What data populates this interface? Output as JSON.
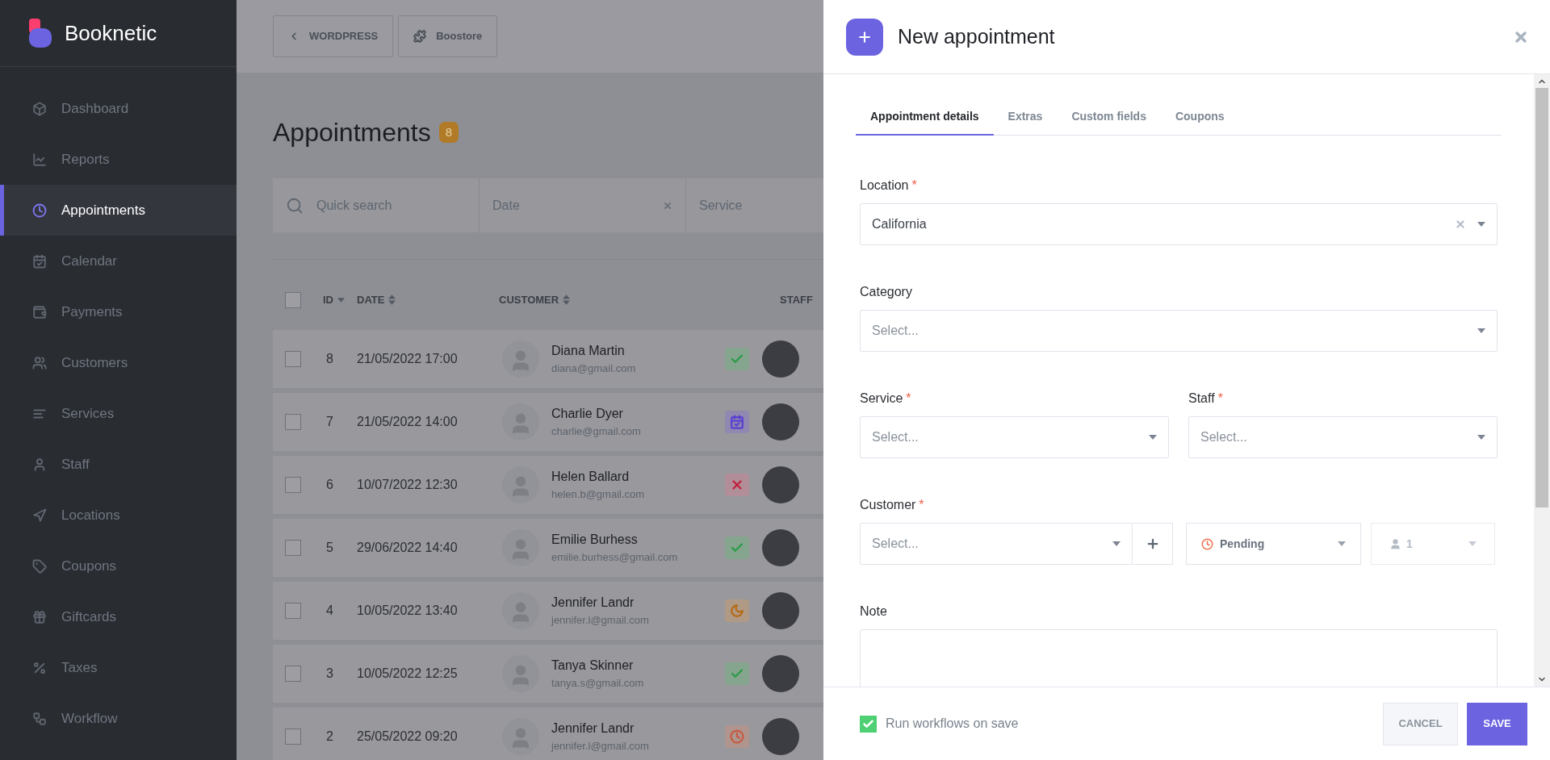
{
  "sidebar": {
    "brand": "Booknetic",
    "items": [
      {
        "label": "Dashboard",
        "kind": "cube",
        "selected": false
      },
      {
        "label": "Reports",
        "kind": "chart",
        "selected": false
      },
      {
        "label": "Appointments",
        "kind": "clock",
        "selected": true
      },
      {
        "label": "Calendar",
        "kind": "calendar",
        "selected": false
      },
      {
        "label": "Payments",
        "kind": "wallet",
        "selected": false
      },
      {
        "label": "Customers",
        "kind": "users",
        "selected": false
      },
      {
        "label": "Services",
        "kind": "lines",
        "selected": false
      },
      {
        "label": "Staff",
        "kind": "user",
        "selected": false
      },
      {
        "label": "Locations",
        "kind": "arrow",
        "selected": false
      },
      {
        "label": "Coupons",
        "kind": "tag",
        "selected": false
      },
      {
        "label": "Giftcards",
        "kind": "gift",
        "selected": false
      },
      {
        "label": "Taxes",
        "kind": "percent",
        "selected": false
      },
      {
        "label": "Workflow",
        "kind": "flow",
        "selected": false
      }
    ]
  },
  "topbar": {
    "buttons": [
      {
        "label": "WORDPRESS",
        "kind": "back"
      },
      {
        "label": "Boostore",
        "kind": "store"
      }
    ]
  },
  "page": {
    "title": "Appointments",
    "count": "8"
  },
  "filters": [
    {
      "kind": "search",
      "placeholder": "Quick search"
    },
    {
      "kind": "date",
      "placeholder": "Date"
    },
    {
      "kind": "select",
      "placeholder": "Service"
    }
  ],
  "table": {
    "select_all_checked": false,
    "columns": [
      {
        "label": "ID",
        "kind": "desc"
      },
      {
        "label": "DATE",
        "kind": "both"
      },
      {
        "label": "CUSTOMER",
        "kind": "both"
      },
      {
        "label": "STAFF",
        "kind": "plain"
      }
    ],
    "rows": [
      {
        "id": "8",
        "date": "21/05/2022 17:00",
        "name": "Diana Martin",
        "email": "diana@gmail.com",
        "kind": "approved",
        "checked": false
      },
      {
        "id": "7",
        "date": "21/05/2022 14:00",
        "name": "Charlie Dyer",
        "email": "charlie@gmail.com",
        "kind": "scheduled",
        "checked": false
      },
      {
        "id": "6",
        "date": "10/07/2022 12:30",
        "name": "Helen Ballard",
        "email": "helen.b@gmail.com",
        "kind": "rejected",
        "checked": false
      },
      {
        "id": "5",
        "date": "29/06/2022 14:40",
        "name": "Emilie Burhess",
        "email": "emilie.burhess@gmail.com",
        "kind": "approved",
        "checked": false
      },
      {
        "id": "4",
        "date": "10/05/2022 13:40",
        "name": "Jennifer Landr",
        "email": "jennifer.l@gmail.com",
        "kind": "night",
        "checked": false
      },
      {
        "id": "3",
        "date": "10/05/2022 12:25",
        "name": "Tanya Skinner",
        "email": "tanya.s@gmail.com",
        "kind": "approved",
        "checked": false
      },
      {
        "id": "2",
        "date": "25/05/2022 09:20",
        "name": "Jennifer Landr",
        "email": "jennifer.l@gmail.com",
        "kind": "pending",
        "checked": false
      }
    ]
  },
  "panel": {
    "title": "New appointment",
    "tabs": [
      {
        "label": "Appointment details",
        "selected": true
      },
      {
        "label": "Extras",
        "selected": false
      },
      {
        "label": "Custom fields",
        "selected": false
      },
      {
        "label": "Coupons",
        "selected": false
      }
    ],
    "location": {
      "label": "Location",
      "required_mark": "*",
      "value": "California"
    },
    "category": {
      "label": "Category",
      "placeholder": "Select..."
    },
    "service": {
      "label": "Service",
      "required_mark": "*",
      "placeholder": "Select..."
    },
    "staff": {
      "label": "Staff",
      "required_mark": "*",
      "placeholder": "Select..."
    },
    "customer": {
      "label": "Customer",
      "required_mark": "*",
      "placeholder": "Select...",
      "status": "Pending",
      "count": "1"
    },
    "note": {
      "label": "Note"
    },
    "footer": {
      "run_workflows": {
        "label": "Run workflows on save",
        "checked": true
      },
      "cancel": "CANCEL",
      "save": "SAVE"
    }
  }
}
